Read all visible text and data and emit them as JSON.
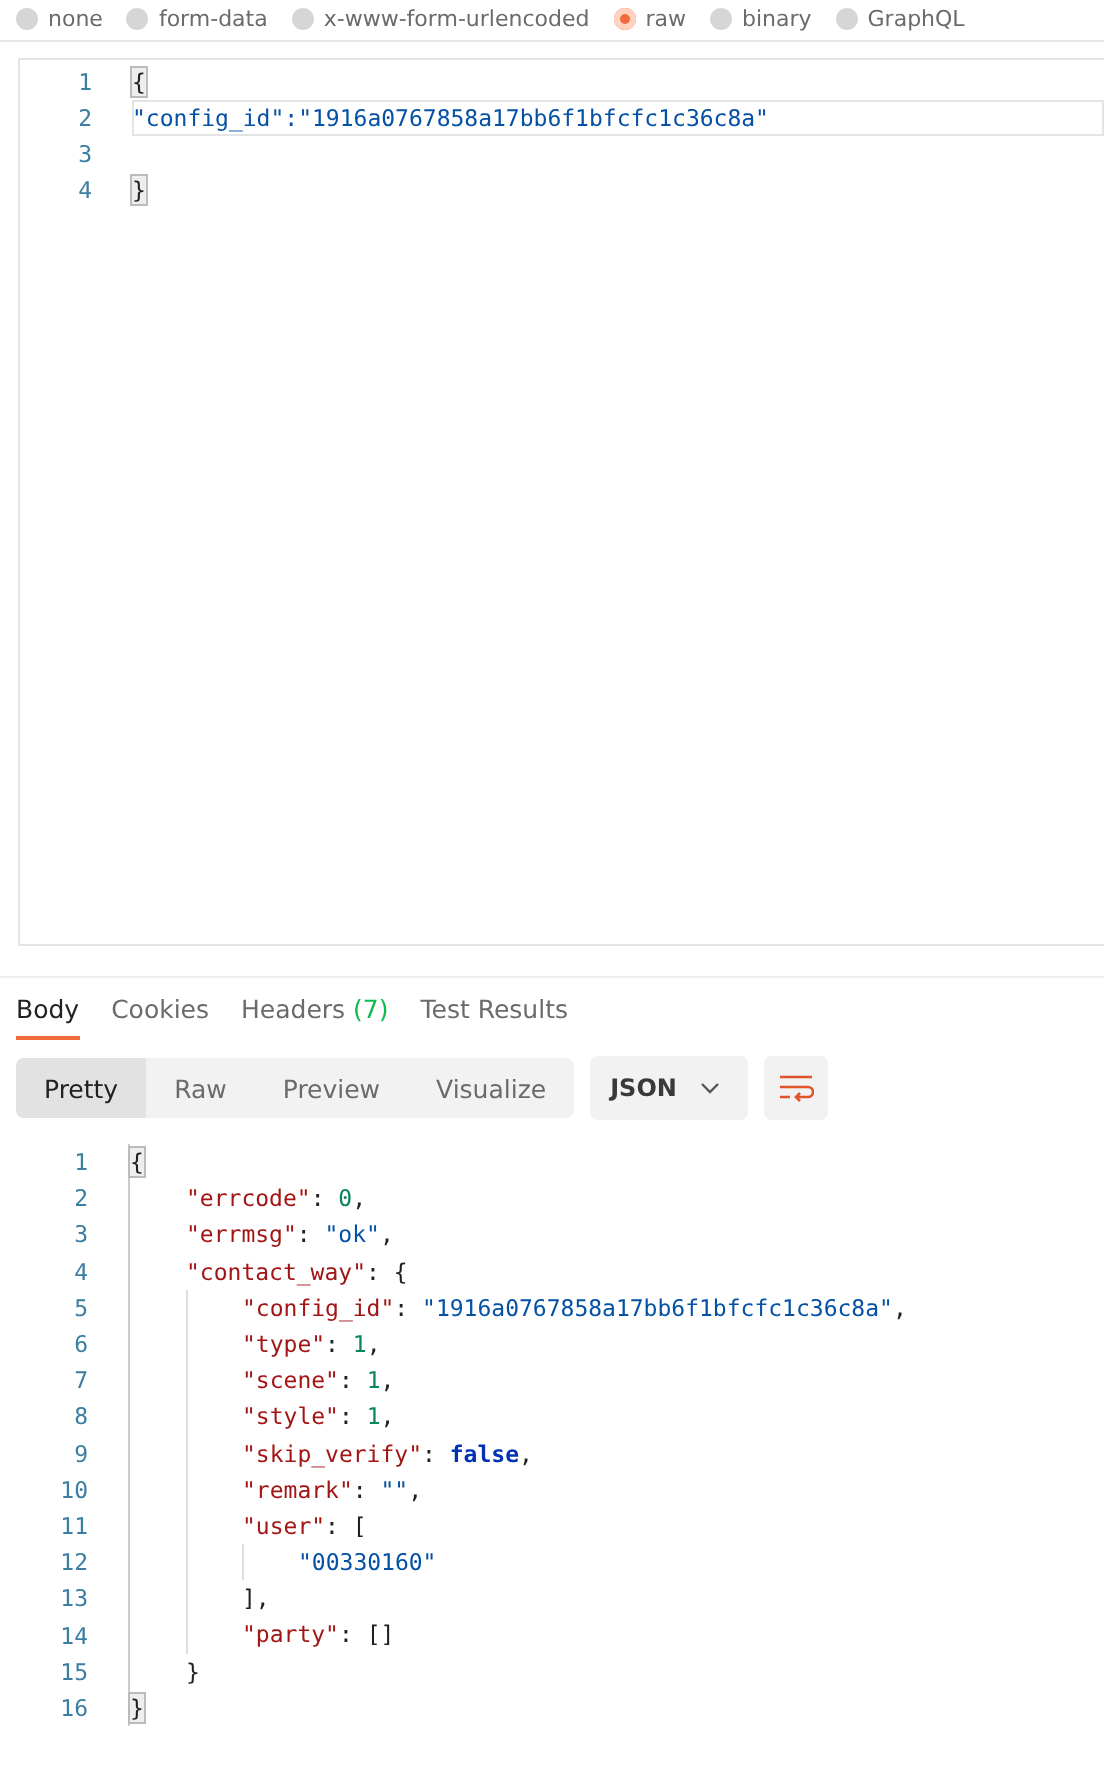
{
  "body_types": [
    {
      "label": "none",
      "selected": false
    },
    {
      "label": "form-data",
      "selected": false
    },
    {
      "label": "x-www-form-urlencoded",
      "selected": false
    },
    {
      "label": "raw",
      "selected": true
    },
    {
      "label": "binary",
      "selected": false
    },
    {
      "label": "GraphQL",
      "selected": false
    }
  ],
  "request_editor": {
    "lines": [
      {
        "number": "1",
        "active": false,
        "tokens": [
          {
            "kind": "bracket",
            "text": "{"
          }
        ]
      },
      {
        "number": "2",
        "active": true,
        "tokens": [
          {
            "kind": "string",
            "text": "\"config_id\":\"1916a0767858a17bb6f1bfcfc1c36c8a\""
          }
        ]
      },
      {
        "number": "3",
        "active": false
      },
      {
        "number": "4",
        "active": false,
        "tokens": [
          {
            "kind": "bracket",
            "text": "}"
          }
        ]
      }
    ]
  },
  "response_tabs": [
    {
      "label": "Body",
      "selected": true
    },
    {
      "label": "Cookies",
      "selected": false
    },
    {
      "label": "Headers",
      "count": "(7)",
      "selected": false
    },
    {
      "label": "Test Results",
      "selected": false
    }
  ],
  "view_modes": [
    {
      "label": "Pretty",
      "selected": true
    },
    {
      "label": "Raw",
      "selected": false
    },
    {
      "label": "Preview",
      "selected": false
    },
    {
      "label": "Visualize",
      "selected": false
    }
  ],
  "format_dropdown": {
    "value": "JSON"
  },
  "response_body": {
    "lines": [
      {
        "number": "1",
        "tokens": [
          {
            "kind": "bracket",
            "text": "{"
          }
        ],
        "children": [
          {
            "number": "2",
            "tokens": [
              {
                "kind": "key",
                "text": "\"errcode\""
              },
              {
                "kind": "punct",
                "text": ": "
              },
              {
                "kind": "number",
                "text": "0"
              },
              {
                "kind": "punct",
                "text": ","
              }
            ]
          },
          {
            "number": "3",
            "tokens": [
              {
                "kind": "key",
                "text": "\"errmsg\""
              },
              {
                "kind": "punct",
                "text": ": "
              },
              {
                "kind": "string",
                "text": "\"ok\""
              },
              {
                "kind": "punct",
                "text": ","
              }
            ]
          },
          {
            "number": "4",
            "tokens": [
              {
                "kind": "key",
                "text": "\"contact_way\""
              },
              {
                "kind": "punct",
                "text": ": {"
              }
            ],
            "children": [
              {
                "number": "5",
                "tokens": [
                  {
                    "kind": "key",
                    "text": "\"config_id\""
                  },
                  {
                    "kind": "punct",
                    "text": ": "
                  },
                  {
                    "kind": "string",
                    "text": "\"1916a0767858a17bb6f1bfcfc1c36c8a\""
                  },
                  {
                    "kind": "punct",
                    "text": ","
                  }
                ]
              },
              {
                "number": "6",
                "tokens": [
                  {
                    "kind": "key",
                    "text": "\"type\""
                  },
                  {
                    "kind": "punct",
                    "text": ": "
                  },
                  {
                    "kind": "number",
                    "text": "1"
                  },
                  {
                    "kind": "punct",
                    "text": ","
                  }
                ]
              },
              {
                "number": "7",
                "tokens": [
                  {
                    "kind": "key",
                    "text": "\"scene\""
                  },
                  {
                    "kind": "punct",
                    "text": ": "
                  },
                  {
                    "kind": "number",
                    "text": "1"
                  },
                  {
                    "kind": "punct",
                    "text": ","
                  }
                ]
              },
              {
                "number": "8",
                "tokens": [
                  {
                    "kind": "key",
                    "text": "\"style\""
                  },
                  {
                    "kind": "punct",
                    "text": ": "
                  },
                  {
                    "kind": "number",
                    "text": "1"
                  },
                  {
                    "kind": "punct",
                    "text": ","
                  }
                ]
              },
              {
                "number": "9",
                "tokens": [
                  {
                    "kind": "key",
                    "text": "\"skip_verify\""
                  },
                  {
                    "kind": "punct",
                    "text": ": "
                  },
                  {
                    "kind": "boolean",
                    "text": "false"
                  },
                  {
                    "kind": "punct",
                    "text": ","
                  }
                ]
              },
              {
                "number": "10",
                "tokens": [
                  {
                    "kind": "key",
                    "text": "\"remark\""
                  },
                  {
                    "kind": "punct",
                    "text": ": "
                  },
                  {
                    "kind": "string",
                    "text": "\"\""
                  },
                  {
                    "kind": "punct",
                    "text": ","
                  }
                ]
              },
              {
                "number": "11",
                "tokens": [
                  {
                    "kind": "key",
                    "text": "\"user\""
                  },
                  {
                    "kind": "punct",
                    "text": ": ["
                  }
                ],
                "children": [
                  {
                    "number": "12",
                    "tokens": [
                      {
                        "kind": "string",
                        "text": "\"00330160\""
                      }
                    ]
                  }
                ]
              },
              {
                "number": "13",
                "tokens": [
                  {
                    "kind": "punct",
                    "text": "],"
                  }
                ]
              },
              {
                "number": "14",
                "tokens": [
                  {
                    "kind": "key",
                    "text": "\"party\""
                  },
                  {
                    "kind": "punct",
                    "text": ": []"
                  }
                ]
              }
            ]
          },
          {
            "number": "15",
            "tokens": [
              {
                "kind": "punct",
                "text": "}"
              }
            ]
          }
        ]
      },
      {
        "number": "16",
        "tokens": [
          {
            "kind": "bracket",
            "text": "}"
          }
        ]
      }
    ]
  }
}
